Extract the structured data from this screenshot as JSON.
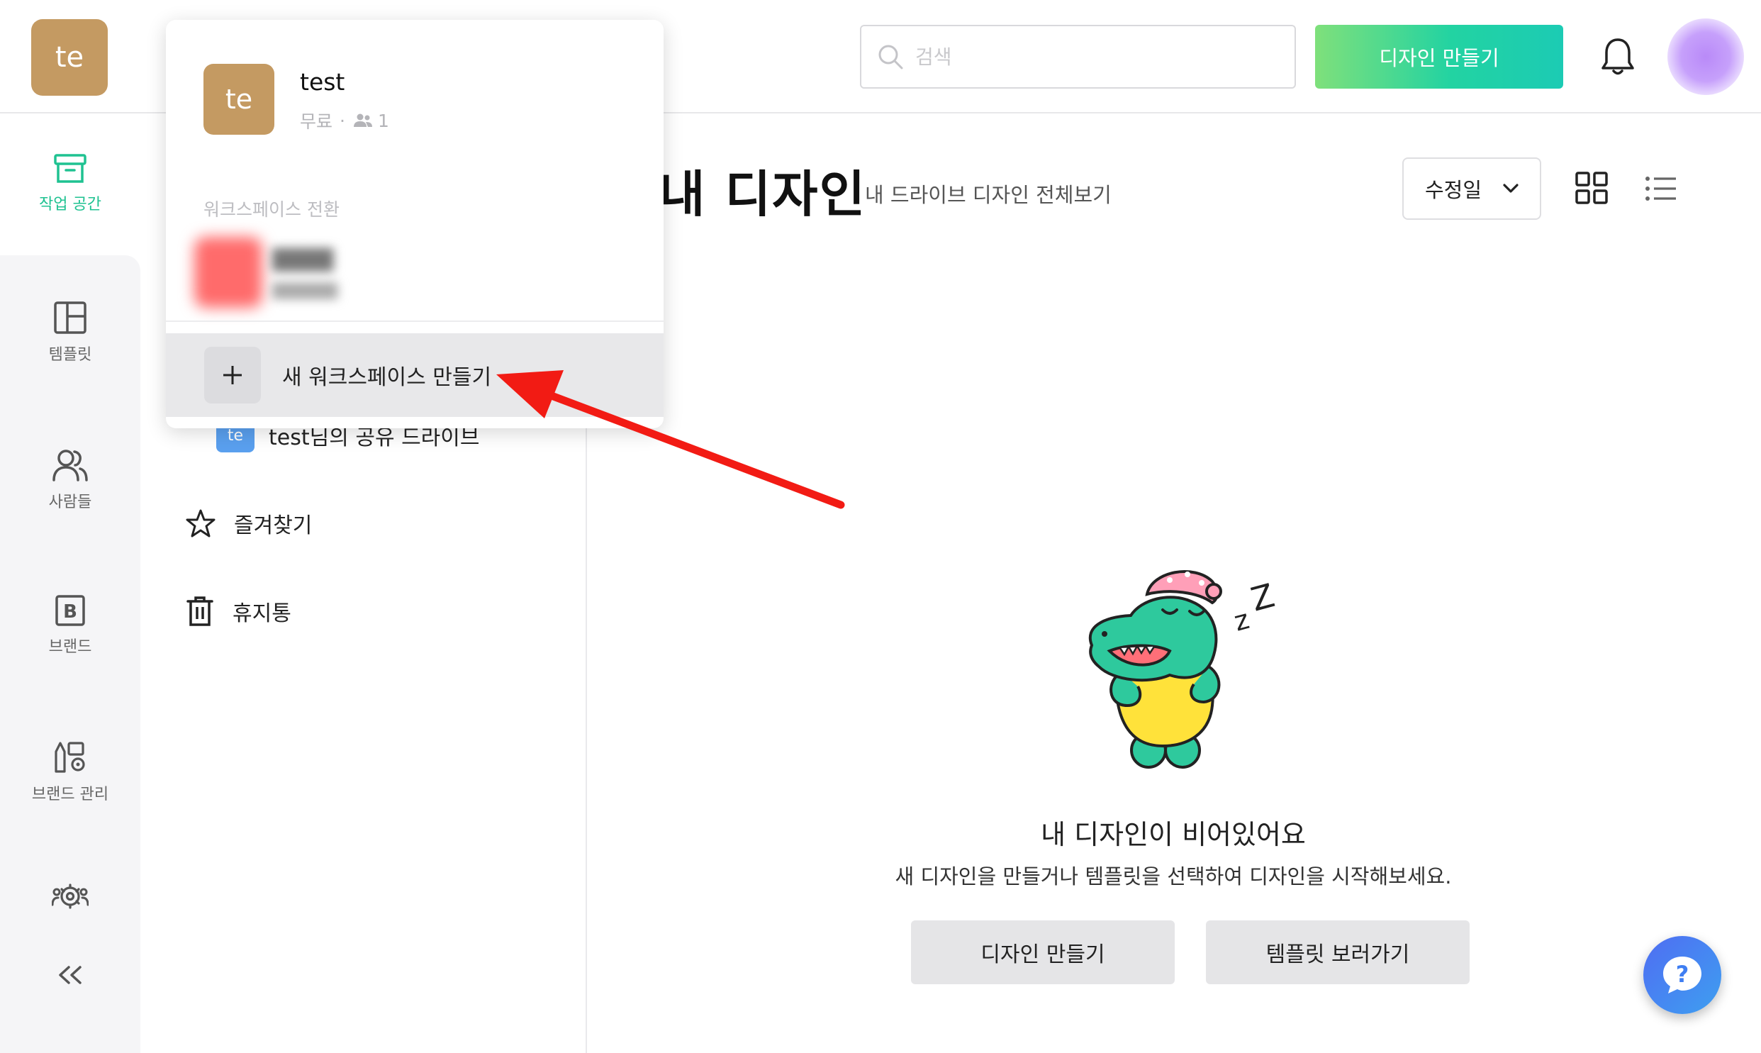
{
  "header": {
    "logo_initials": "te",
    "search_placeholder": "검색",
    "create_design_label": "디자인 만들기"
  },
  "rail": {
    "items": [
      {
        "label": "작업 공간",
        "icon": "archive-icon",
        "active": true
      },
      {
        "label": "템플릿",
        "icon": "layout-icon"
      },
      {
        "label": "사람들",
        "icon": "people-icon"
      },
      {
        "label": "브랜드",
        "icon": "brand-b-icon"
      },
      {
        "label": "브랜드 관리",
        "icon": "brand-settings-icon"
      },
      {
        "label": "",
        "icon": "team-settings-icon"
      },
      {
        "label": "",
        "icon": "collapse-icon"
      }
    ]
  },
  "sidebar": {
    "shared_drive_badge": "te",
    "shared_drive_label": "test님의 공유 드라이브",
    "favorites_label": "즐겨찾기",
    "trash_label": "휴지통"
  },
  "main": {
    "title": "내 디자인",
    "subtitle": "내 드라이브 디자인 전체보기",
    "sort_label": "수정일",
    "empty_title": "내 디자인이 비어있어요",
    "empty_desc": "새 디자인을 만들거나 템플릿을 선택하여 디자인을 시작해보세요.",
    "empty_create_button": "디자인 만들기",
    "empty_templates_button": "템플릿 보러가기",
    "help_label": "?"
  },
  "workspace_popup": {
    "avatar_initials": "te",
    "name": "test",
    "plan": "무료",
    "separator": "·",
    "member_count": "1",
    "switch_label": "워크스페이스 전환",
    "new_workspace_label": "새 워크스페이스 만들기"
  },
  "colors": {
    "accent_green": "#1fc291",
    "avatar_brown": "#c49a62",
    "annotation_red": "#f21b14",
    "create_gradient_start": "#7fe07b",
    "create_gradient_end": "#1ccbb4"
  }
}
